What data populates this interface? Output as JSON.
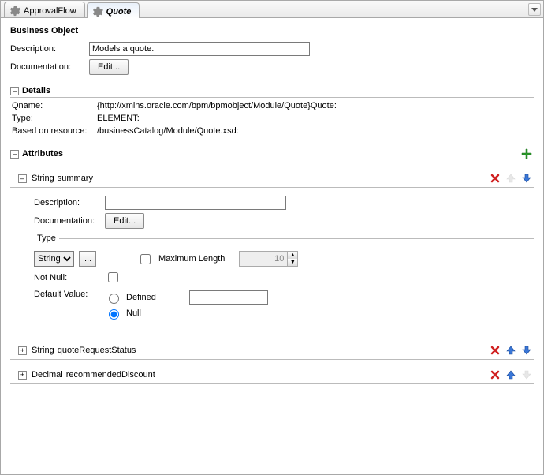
{
  "tabs": [
    {
      "label": "ApprovalFlow",
      "active": false
    },
    {
      "label": "Quote",
      "active": true
    }
  ],
  "businessObject": {
    "title": "Business Object",
    "descriptionLabel": "Description:",
    "descriptionValue": "Models a quote.",
    "documentationLabel": "Documentation:",
    "editButton": "Edit..."
  },
  "details": {
    "title": "Details",
    "qnameLabel": "Qname:",
    "qnameValue": "{http://xmlns.oracle.com/bpm/bpmobject/Module/Quote}Quote:",
    "typeLabel": "Type:",
    "typeValue": "ELEMENT:",
    "basedOnLabel": "Based on resource:",
    "basedOnValue": "/businessCatalog/Module/Quote.xsd:"
  },
  "attributesSection": {
    "title": "Attributes"
  },
  "attributes": [
    {
      "type": "String",
      "name": "summary",
      "expanded": true,
      "canUp": false,
      "canDown": true,
      "body": {
        "descriptionLabel": "Description:",
        "descriptionValue": "",
        "documentationLabel": "Documentation:",
        "editButton": "Edit...",
        "typeLegend": "Type",
        "typeSelect": "String",
        "browseButton": "...",
        "maxLengthLabel": "Maximum Length",
        "maxLengthValue": "10",
        "maxLengthChecked": false,
        "notNullLabel": "Not Null:",
        "notNullChecked": false,
        "defaultValueLabel": "Default Value:",
        "definedLabel": "Defined",
        "definedValue": "",
        "nullLabel": "Null",
        "defaultIsNull": true
      }
    },
    {
      "type": "String",
      "name": "quoteRequestStatus",
      "expanded": false,
      "canUp": true,
      "canDown": true
    },
    {
      "type": "Decimal",
      "name": "recommendedDiscount",
      "expanded": false,
      "canUp": true,
      "canDown": false
    }
  ]
}
